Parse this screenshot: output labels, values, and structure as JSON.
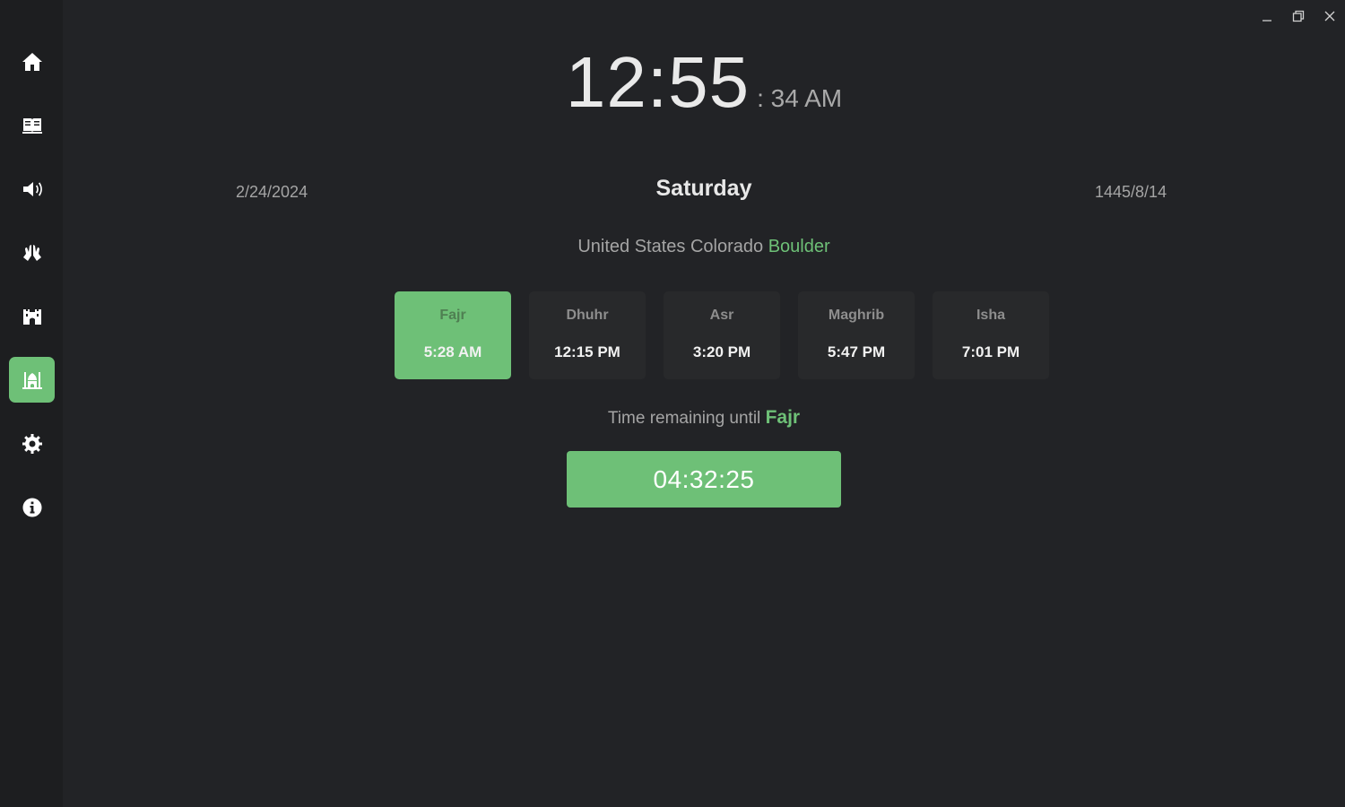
{
  "window_controls": {
    "minimize_icon": "minimize-icon",
    "restore_icon": "restore-icon",
    "close_icon": "close-icon"
  },
  "sidebar": {
    "items": [
      {
        "icon": "home-icon",
        "active": false
      },
      {
        "icon": "book-icon",
        "active": false
      },
      {
        "icon": "speaker-icon",
        "active": false
      },
      {
        "icon": "praying-hands-icon",
        "active": false
      },
      {
        "icon": "castle-icon",
        "active": false
      },
      {
        "icon": "mosque-icon",
        "active": true
      },
      {
        "icon": "gear-icon",
        "active": false
      },
      {
        "icon": "info-icon",
        "active": false
      }
    ]
  },
  "clock": {
    "hours_minutes": "12:55",
    "seconds_ampm": ": 34 AM"
  },
  "dates": {
    "gregorian": "2/24/2024",
    "weekday": "Saturday",
    "hijri": "1445/8/14"
  },
  "location": {
    "country": "United States",
    "region": "Colorado",
    "city": "Boulder"
  },
  "prayers": [
    {
      "name": "Fajr",
      "time": "5:28 AM",
      "active": true
    },
    {
      "name": "Dhuhr",
      "time": "12:15 PM",
      "active": false
    },
    {
      "name": "Asr",
      "time": "3:20 PM",
      "active": false
    },
    {
      "name": "Maghrib",
      "time": "5:47 PM",
      "active": false
    },
    {
      "name": "Isha",
      "time": "7:01 PM",
      "active": false
    }
  ],
  "remaining": {
    "label": "Time remaining until",
    "next_prayer": "Fajr",
    "countdown": "04:32:25"
  },
  "colors": {
    "accent": "#6ec077",
    "background": "#222326",
    "sidebar": "#1d1e20",
    "card": "#28292b"
  }
}
